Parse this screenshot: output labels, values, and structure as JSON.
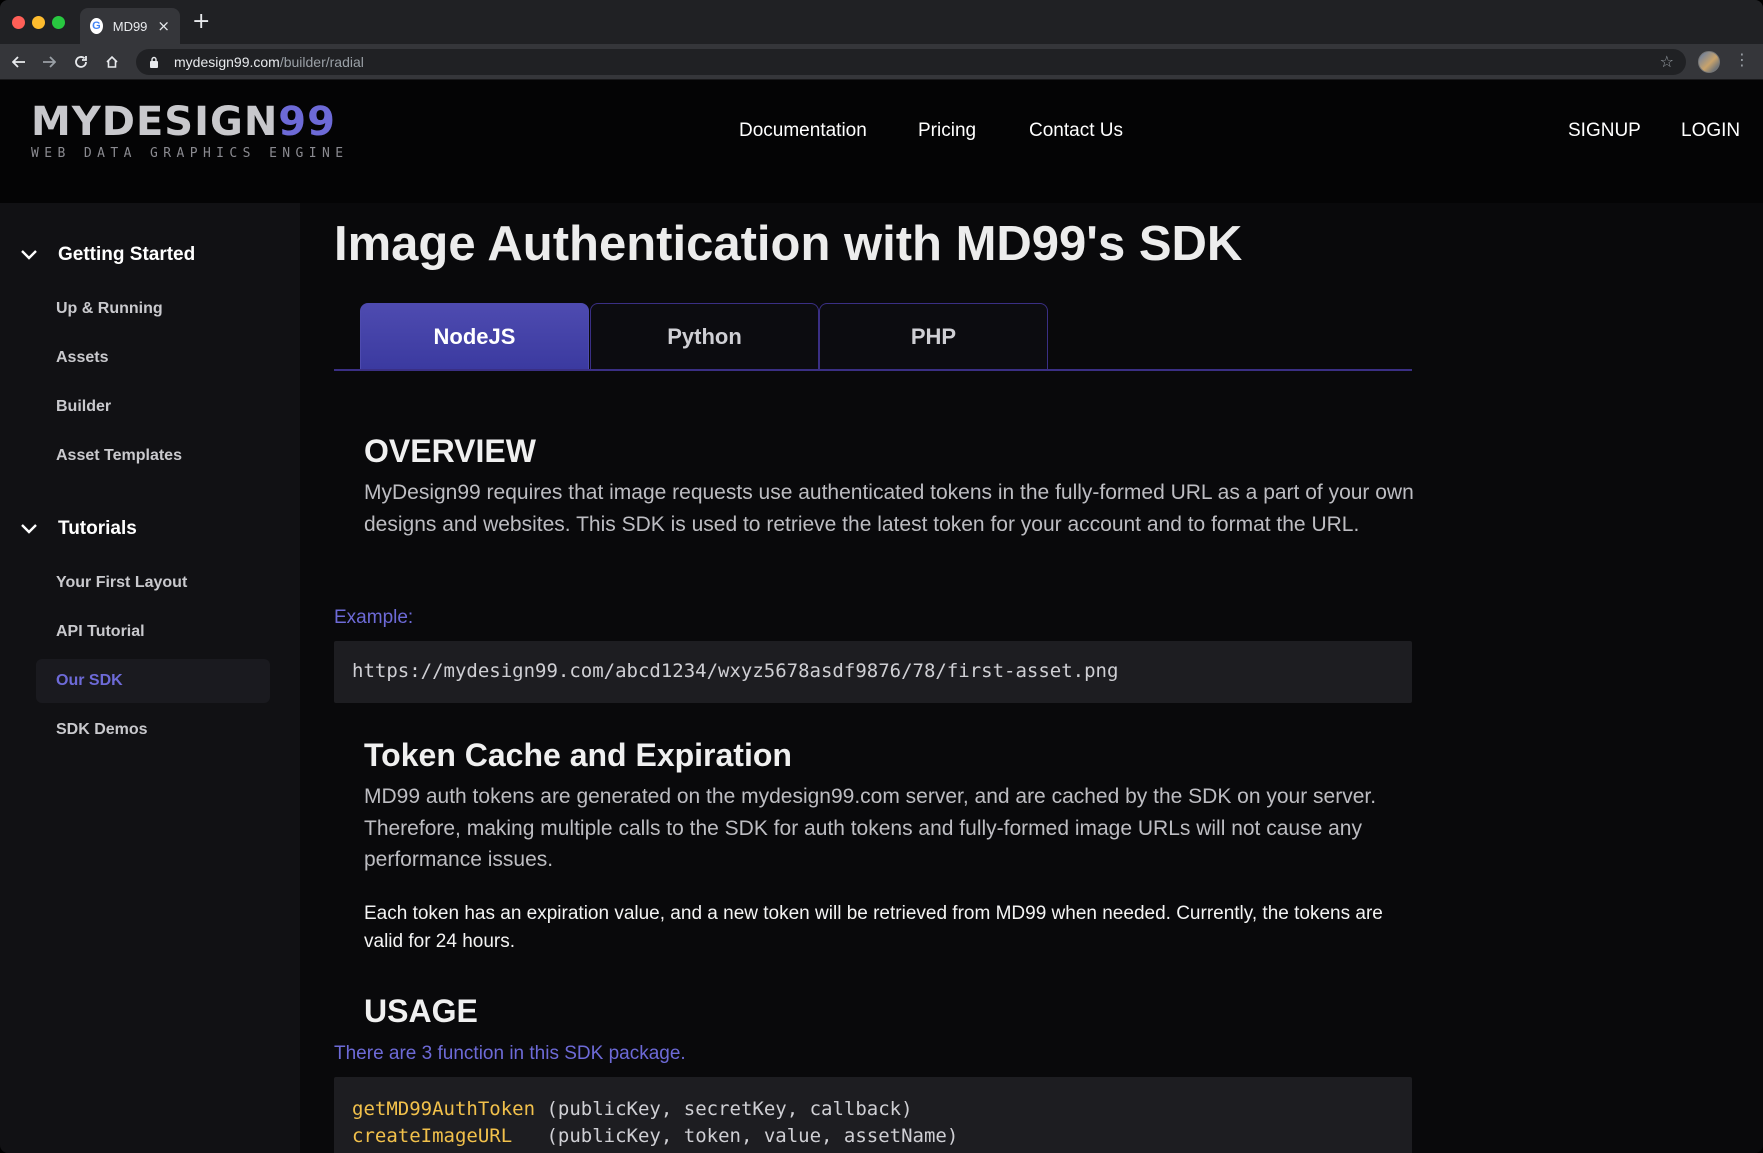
{
  "browser": {
    "tab_title": "MD99",
    "favicon": "G",
    "url_host": "mydesign99.com",
    "url_path": "/builder/radial"
  },
  "site": {
    "logo_main": "MYDESIGN",
    "logo_99": "99",
    "logo_sub": "WEB DATA GRAPHICS ENGINE",
    "nav": {
      "documentation": "Documentation",
      "pricing": "Pricing",
      "contact": "Contact Us",
      "signup": "SIGNUP",
      "login": "LOGIN"
    }
  },
  "sidebar": {
    "groups": [
      {
        "label": "Getting Started",
        "items": [
          "Up & Running",
          "Assets",
          "Builder",
          "Asset Templates"
        ]
      },
      {
        "label": "Tutorials",
        "items": [
          "Your First Layout",
          "API Tutorial",
          "Our SDK",
          "SDK Demos"
        ]
      }
    ],
    "active_item": "Our SDK"
  },
  "main": {
    "title": "Image Authentication with MD99's SDK",
    "tabs": [
      "NodeJS",
      "Python",
      "PHP"
    ],
    "active_tab": "NodeJS",
    "overview_heading": "OVERVIEW",
    "overview_text": "MyDesign99 requires that image requests use authenticated tokens in the fully-formed URL as a part of your own designs and websites. This SDK is used to retrieve the latest token for your account and to format the URL.",
    "example_label": "Example:",
    "example_url": "https://mydesign99.com/abcd1234/wxyz5678asdf9876/78/first-asset.png",
    "cache_heading": "Token Cache and Expiration",
    "cache_text": "MD99 auth tokens are generated on the mydesign99.com server, and are cached by the SDK on your server. Therefore, making multiple calls to the SDK for auth tokens and fully-formed image URLs will not cause any performance issues.",
    "expiry_text": "Each token has an expiration value, and a new token will be retrieved from MD99 when needed. Currently, the tokens are valid for 24 hours.",
    "usage_heading": "USAGE",
    "usage_intro": "There are 3 function in this SDK package.",
    "functions": [
      {
        "name": "getMD99AuthToken",
        "pad": " ",
        "args": "(publicKey, secretKey, callback)"
      },
      {
        "name": "createImageURL",
        "pad": "   ",
        "args": "(publicKey, token, value, assetName)"
      }
    ]
  },
  "colors": {
    "accent": "#6d6ad7",
    "function_name": "#f2c14b",
    "tab_active": "#4e4bb0"
  }
}
